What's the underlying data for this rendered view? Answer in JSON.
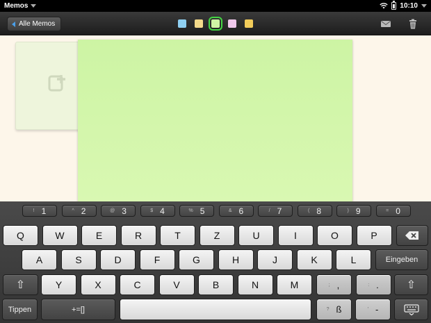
{
  "statusbar": {
    "app_name": "Memos",
    "time": "10:10"
  },
  "toolbar": {
    "back_label": "Alle Memos",
    "colors": [
      "#8fd0f2",
      "#f3da8a",
      "#cff5a5",
      "#f0c8ec",
      "#f2cc5a"
    ],
    "selected_color_index": 2
  },
  "note": {
    "color": "#d2f6aa",
    "text": ""
  },
  "keyboard": {
    "number_row": [
      {
        "alt": "!",
        "main": "1"
      },
      {
        "alt": "^",
        "main": "2"
      },
      {
        "alt": "@",
        "main": "3"
      },
      {
        "alt": "$",
        "main": "4"
      },
      {
        "alt": "%",
        "main": "5"
      },
      {
        "alt": "&",
        "main": "6"
      },
      {
        "alt": "/",
        "main": "7"
      },
      {
        "alt": "(",
        "main": "8"
      },
      {
        "alt": ")",
        "main": "9"
      },
      {
        "alt": "=",
        "main": "0"
      }
    ],
    "row1": [
      "Q",
      "W",
      "E",
      "R",
      "T",
      "Z",
      "U",
      "I",
      "O",
      "P"
    ],
    "row2": [
      "A",
      "S",
      "D",
      "F",
      "G",
      "H",
      "J",
      "K",
      "L"
    ],
    "row3": [
      "Y",
      "X",
      "C",
      "V",
      "B",
      "N",
      "M"
    ],
    "enter_label": "Eingeben",
    "sym_keys": [
      {
        "alt": ";",
        "main": ","
      },
      {
        "alt": ":",
        "main": "."
      },
      {
        "alt": "?",
        "main": "ß"
      },
      {
        "alt": "'",
        "main": "-"
      }
    ],
    "tippen_label": "Tippen",
    "symbols_label": "+=[]"
  }
}
